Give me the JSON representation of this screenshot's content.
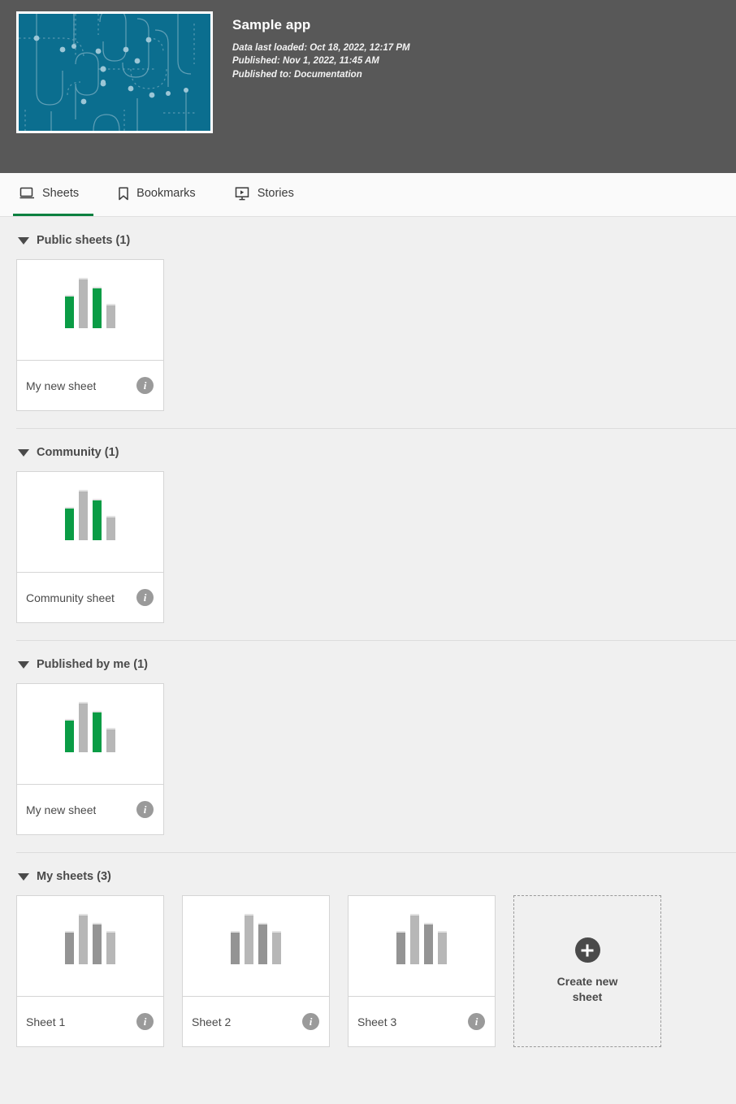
{
  "header": {
    "app_title": "Sample app",
    "thumbnail_color": "#0b6e8f",
    "background_color": "#585858",
    "meta": [
      "Data last loaded: Oct 18, 2022, 12:17 PM",
      "Published: Nov 1, 2022, 11:45 AM",
      "Published to: Documentation"
    ]
  },
  "tabs": {
    "active_accent": "#0a8040",
    "items": [
      {
        "label": "Sheets",
        "icon": "sheets-icon",
        "active": true
      },
      {
        "label": "Bookmarks",
        "icon": "bookmark-icon",
        "active": false
      },
      {
        "label": "Stories",
        "icon": "story-icon",
        "active": false
      }
    ]
  },
  "colors": {
    "bar_green": "#0a9c45",
    "bar_gray_light": "#b7b7b7",
    "bar_gray_dark": "#949494",
    "bar_top_edge": "#e3e3e3",
    "content_bg": "#f0f0f0",
    "card_bg": "#ffffff",
    "card_border": "#d5d5d5",
    "info_icon_bg": "#9a9a9a"
  },
  "info_icon_glyph": "i",
  "sections": [
    {
      "key": "public-sheets",
      "title": "Public sheets (1)",
      "count": 1,
      "expanded": true,
      "sheets": [
        {
          "name": "My new sheet",
          "chart": {
            "type": "bar",
            "values": [
              38,
              58,
              48,
              28
            ],
            "colors": [
              "#0a9c45",
              "#b7b7b7",
              "#0a9c45",
              "#b7b7b7"
            ]
          }
        }
      ]
    },
    {
      "key": "community",
      "title": "Community (1)",
      "count": 1,
      "expanded": true,
      "sheets": [
        {
          "name": "Community sheet",
          "chart": {
            "type": "bar",
            "values": [
              38,
              58,
              48,
              28
            ],
            "colors": [
              "#0a9c45",
              "#b7b7b7",
              "#0a9c45",
              "#b7b7b7"
            ]
          }
        }
      ]
    },
    {
      "key": "published-by-me",
      "title": "Published by me (1)",
      "count": 1,
      "expanded": true,
      "sheets": [
        {
          "name": "My new sheet",
          "chart": {
            "type": "bar",
            "values": [
              38,
              58,
              48,
              28
            ],
            "colors": [
              "#0a9c45",
              "#b7b7b7",
              "#0a9c45",
              "#b7b7b7"
            ]
          }
        }
      ]
    },
    {
      "key": "my-sheets",
      "title": "My sheets (3)",
      "count": 3,
      "expanded": true,
      "create_new_label": "Create new sheet",
      "sheets": [
        {
          "name": "Sheet 1",
          "chart": {
            "type": "bar",
            "values": [
              38,
              58,
              48,
              38
            ],
            "colors": [
              "#949494",
              "#b7b7b7",
              "#949494",
              "#b7b7b7"
            ]
          }
        },
        {
          "name": "Sheet 2",
          "chart": {
            "type": "bar",
            "values": [
              38,
              58,
              48,
              38
            ],
            "colors": [
              "#949494",
              "#b7b7b7",
              "#949494",
              "#b7b7b7"
            ]
          }
        },
        {
          "name": "Sheet 3",
          "chart": {
            "type": "bar",
            "values": [
              38,
              58,
              48,
              38
            ],
            "colors": [
              "#949494",
              "#b7b7b7",
              "#949494",
              "#b7b7b7"
            ]
          }
        }
      ]
    }
  ]
}
